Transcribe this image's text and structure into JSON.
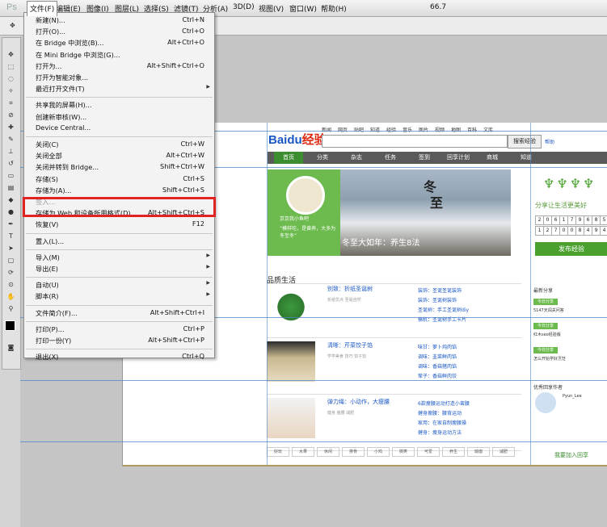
{
  "app": {
    "logo": "Ps"
  },
  "menubar": {
    "items": [
      {
        "label": "文件(F)",
        "name": "file"
      },
      {
        "label": "编辑(E)",
        "name": "edit"
      },
      {
        "label": "图像(I)",
        "name": "image"
      },
      {
        "label": "图层(L)",
        "name": "layer"
      },
      {
        "label": "选择(S)",
        "name": "select"
      },
      {
        "label": "滤镜(T)",
        "name": "filter"
      },
      {
        "label": "分析(A)",
        "name": "analysis"
      },
      {
        "label": "3D(D)",
        "name": "3d"
      },
      {
        "label": "视图(V)",
        "name": "view"
      },
      {
        "label": "窗口(W)",
        "name": "window"
      },
      {
        "label": "帮助(H)",
        "name": "help"
      }
    ],
    "zoom": "66.7"
  },
  "file_menu": {
    "groups": [
      [
        {
          "label": "新建(N)...",
          "shortcut": "Ctrl+N"
        },
        {
          "label": "打开(O)...",
          "shortcut": "Ctrl+O"
        },
        {
          "label": "在 Bridge 中浏览(B)...",
          "shortcut": "Alt+Ctrl+O"
        },
        {
          "label": "在 Mini Bridge 中浏览(G)...",
          "shortcut": ""
        },
        {
          "label": "打开为...",
          "shortcut": "Alt+Shift+Ctrl+O"
        },
        {
          "label": "打开为智能对象...",
          "shortcut": ""
        },
        {
          "label": "最近打开文件(T)",
          "shortcut": "",
          "submenu": true
        }
      ],
      [
        {
          "label": "共享我的屏幕(H)...",
          "shortcut": ""
        },
        {
          "label": "创建新审核(W)...",
          "shortcut": ""
        },
        {
          "label": "Device Central...",
          "shortcut": ""
        }
      ],
      [
        {
          "label": "关闭(C)",
          "shortcut": "Ctrl+W"
        },
        {
          "label": "关闭全部",
          "shortcut": "Alt+Ctrl+W"
        },
        {
          "label": "关闭并转到 Bridge...",
          "shortcut": "Shift+Ctrl+W"
        },
        {
          "label": "存储(S)",
          "shortcut": "Ctrl+S"
        },
        {
          "label": "存储为(A)...",
          "shortcut": "Shift+Ctrl+S"
        },
        {
          "label": "签入...",
          "shortcut": "",
          "disabled": true
        },
        {
          "label": "存储为 Web 和设备所用格式(D)...",
          "shortcut": "Alt+Shift+Ctrl+S",
          "highlighted": true
        },
        {
          "label": "恢复(V)",
          "shortcut": "F12"
        }
      ],
      [
        {
          "label": "置入(L)...",
          "shortcut": ""
        }
      ],
      [
        {
          "label": "导入(M)",
          "shortcut": "",
          "submenu": true
        },
        {
          "label": "导出(E)",
          "shortcut": "",
          "submenu": true
        }
      ],
      [
        {
          "label": "自动(U)",
          "shortcut": "",
          "submenu": true
        },
        {
          "label": "脚本(R)",
          "shortcut": "",
          "submenu": true
        }
      ],
      [
        {
          "label": "文件简介(F)...",
          "shortcut": "Alt+Shift+Ctrl+I"
        }
      ],
      [
        {
          "label": "打印(P)...",
          "shortcut": "Ctrl+P"
        },
        {
          "label": "打印一份(Y)",
          "shortcut": "Alt+Shift+Ctrl+P"
        }
      ],
      [
        {
          "label": "退出(X)",
          "shortcut": "Ctrl+Q"
        }
      ]
    ]
  },
  "document": {
    "nav_links": [
      "新闻",
      "网页",
      "贴吧",
      "知道",
      "经验",
      "音乐",
      "图片",
      "视频",
      "地图",
      "百科",
      "文库"
    ],
    "logo_text": "Bai",
    "logo_suffix": "经验",
    "search_button": "搜索经验",
    "help_link": "帮助",
    "tabs": [
      "首页",
      "分类",
      "杂志",
      "任务",
      "签到",
      "回享计划",
      "商城",
      "知道"
    ],
    "banner_text_top": "冬",
    "banner_text_bottom": "至",
    "banner_caption": "冬至大如年：养生8法",
    "green_name": "京京我小鱼吧",
    "green_quote": "“模样吃，是黄养，大多为冬至冬”",
    "slogan": "分享让生活更美好",
    "counters": [
      "2",
      "0",
      "6",
      "1",
      "7",
      "9",
      "6",
      "8",
      "5",
      "1",
      "2",
      "7",
      "0",
      "0",
      "8",
      "4",
      "9",
      "4"
    ],
    "publish_button": "发布经验",
    "section_title": "品质生活",
    "items": [
      {
        "title": "别致：折纸圣诞树",
        "sub": "折纸优点  圣诞自然"
      },
      {
        "title": "清晰：芹菜饺子馅",
        "sub": "学学美食  技巧  饺子馅"
      },
      {
        "title": "弹力绳：小动作，大瘦腰",
        "sub": "健身  瘦腰  减肥"
      }
    ],
    "links": [
      "装饰：圣诞圣诞装饰",
      "装饰：圣诞树装饰",
      "圣诞树：手工圣诞树diy",
      "搞机：圣诞树手工卡片",
      "味甘：萝卜炖肉馅",
      "调味：韭菜鲜肉馅",
      "调味：香菇猪肉馅",
      "荤子：香菇鲜肉饺",
      "6款瘦腰运动打造小蛮腰",
      "健身瘦腰：腰背运动",
      "家用：在家自制瘦腰操",
      "健身：瘦身运动方法"
    ],
    "tags": [
      "好玩",
      "水果",
      "休闲",
      "排骨",
      "小鸡",
      "搞笑",
      "可爱",
      "养生",
      "瑜伽",
      "减肥"
    ],
    "side_head": "最新分享",
    "side_badges": [
      "今日分享",
      "今日分享",
      "今日分享"
    ],
    "side_texts": [
      "5147天闯关问答",
      "红木seo经验版",
      "怎么开始学好烹饪"
    ],
    "side_head2": "优秀回享作者",
    "side_author": "Pyun_Lee",
    "side_join": "我要加入回享"
  }
}
